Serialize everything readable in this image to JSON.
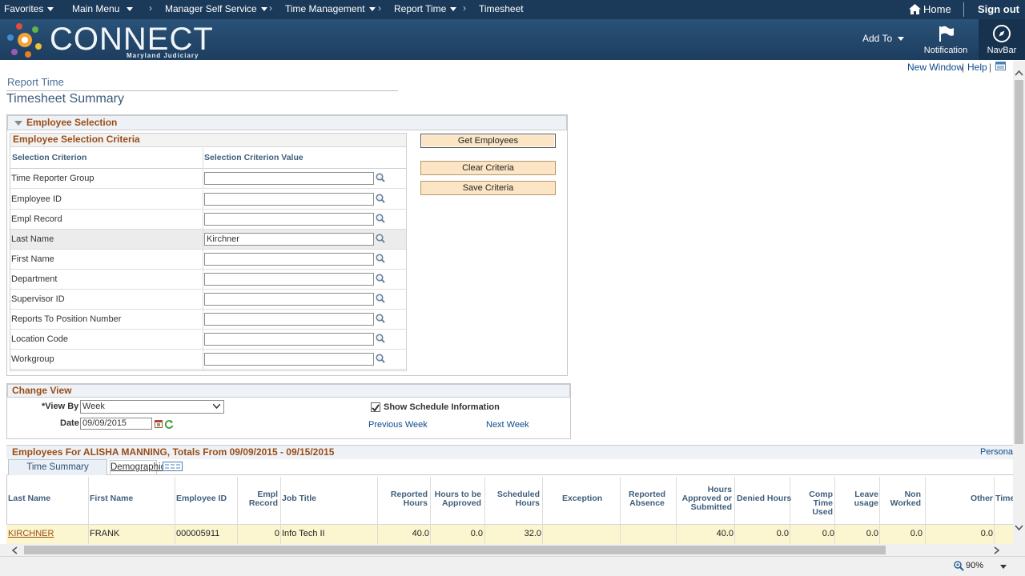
{
  "topnav": {
    "favorites": "Favorites",
    "main_menu": "Main Menu",
    "manager_self_service": "Manager Self Service",
    "time_management": "Time Management",
    "report_time": "Report Time",
    "timesheet": "Timesheet",
    "home": "Home",
    "sign_out": "Sign out"
  },
  "banner": {
    "logo": "CONNECT",
    "logo_sub": "Maryland Judiciary",
    "add_to": "Add To",
    "notification": "Notification",
    "navbar": "NavBar"
  },
  "utility": {
    "new_window": "New Window",
    "help": "Help"
  },
  "page": {
    "breadcrumb": "Report Time",
    "title": "Timesheet Summary"
  },
  "employee_selection": {
    "header": "Employee Selection",
    "criteria_header": "Employee Selection Criteria",
    "col_criterion": "Selection Criterion",
    "col_value": "Selection Criterion Value",
    "rows": [
      {
        "label": "Time Reporter Group",
        "value": ""
      },
      {
        "label": "Employee ID",
        "value": ""
      },
      {
        "label": "Empl Record",
        "value": ""
      },
      {
        "label": "Last Name",
        "value": "Kirchner"
      },
      {
        "label": "First Name",
        "value": ""
      },
      {
        "label": "Department",
        "value": ""
      },
      {
        "label": "Supervisor ID",
        "value": ""
      },
      {
        "label": "Reports To Position Number",
        "value": ""
      },
      {
        "label": "Location Code",
        "value": ""
      },
      {
        "label": "Workgroup",
        "value": ""
      }
    ],
    "buttons": {
      "get_employees": "Get Employees",
      "clear_criteria": "Clear Criteria",
      "save_criteria": "Save Criteria"
    }
  },
  "change_view": {
    "header": "Change View",
    "view_by_label": "*View By",
    "view_by_value": "Week",
    "date_label": "Date",
    "date_value": "09/09/2015",
    "show_schedule": "Show Schedule Information",
    "show_schedule_checked": true,
    "previous_week": "Previous Week",
    "next_week": "Next Week"
  },
  "employees": {
    "header": "Employees For ALISHA MANNING, Totals From 09/09/2015 - 09/15/2015",
    "personalize": "Persona",
    "tabs": [
      "Time Summary",
      "Demographics"
    ],
    "columns": {
      "last_name": "Last Name",
      "first_name": "First Name",
      "employee_id": "Employee ID",
      "empl_record_1": "Empl",
      "empl_record_2": "Record",
      "job_title": "Job Title",
      "reported_hours_1": "Reported",
      "reported_hours_2": "Hours",
      "to_be_approved_1": "Hours to be",
      "to_be_approved_2": "Approved",
      "scheduled_1": "Scheduled",
      "scheduled_2": "Hours",
      "exception": "Exception",
      "reported_absence_1": "Reported",
      "reported_absence_2": "Absence",
      "approved_1": "Hours",
      "approved_2": "Approved or",
      "approved_3": "Submitted",
      "denied": "Denied Hours",
      "comp_1": "Comp",
      "comp_2": "Time Used",
      "leave_1": "Leave",
      "leave_2": "usage",
      "non_1": "Non",
      "non_2": "Worked",
      "other": "Other",
      "time": "Time"
    },
    "row": {
      "last_name": "KIRCHNER",
      "first_name": "FRANK",
      "employee_id": "000005911",
      "empl_record": "0",
      "job_title": "Info Tech II",
      "reported_hours": "40.0",
      "to_be_approved": "0.0",
      "scheduled": "32.0",
      "approved": "40.0",
      "denied": "0.0",
      "comp": "0.0",
      "leave": "0.0",
      "non_worked": "0.0",
      "other": "0.0"
    }
  },
  "status": {
    "zoom": "90%"
  },
  "colors": {
    "nav_bg": "#1b3a5a",
    "section_title": "#9a4d16",
    "button_bg": "#fbe5c4",
    "link": "#0d4b8e",
    "row_highlight": "#fbf6cf"
  }
}
